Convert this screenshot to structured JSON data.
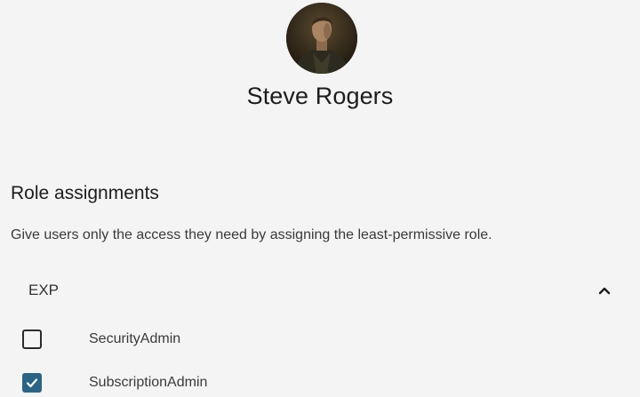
{
  "user": {
    "name": "Steve Rogers"
  },
  "roles_section": {
    "title": "Role assignments",
    "description": "Give users only the access they need by assigning the least-permissive role.",
    "group": {
      "name": "EXP",
      "expanded": true,
      "toggle_icon": "chevron-up-icon"
    },
    "items": [
      {
        "label": "SecurityAdmin",
        "checked": false
      },
      {
        "label": "SubscriptionAdmin",
        "checked": true
      }
    ]
  },
  "colors": {
    "background": "#f4f4f4",
    "checkbox_checked": "#2b6585",
    "text_primary": "#1d1d1d"
  }
}
